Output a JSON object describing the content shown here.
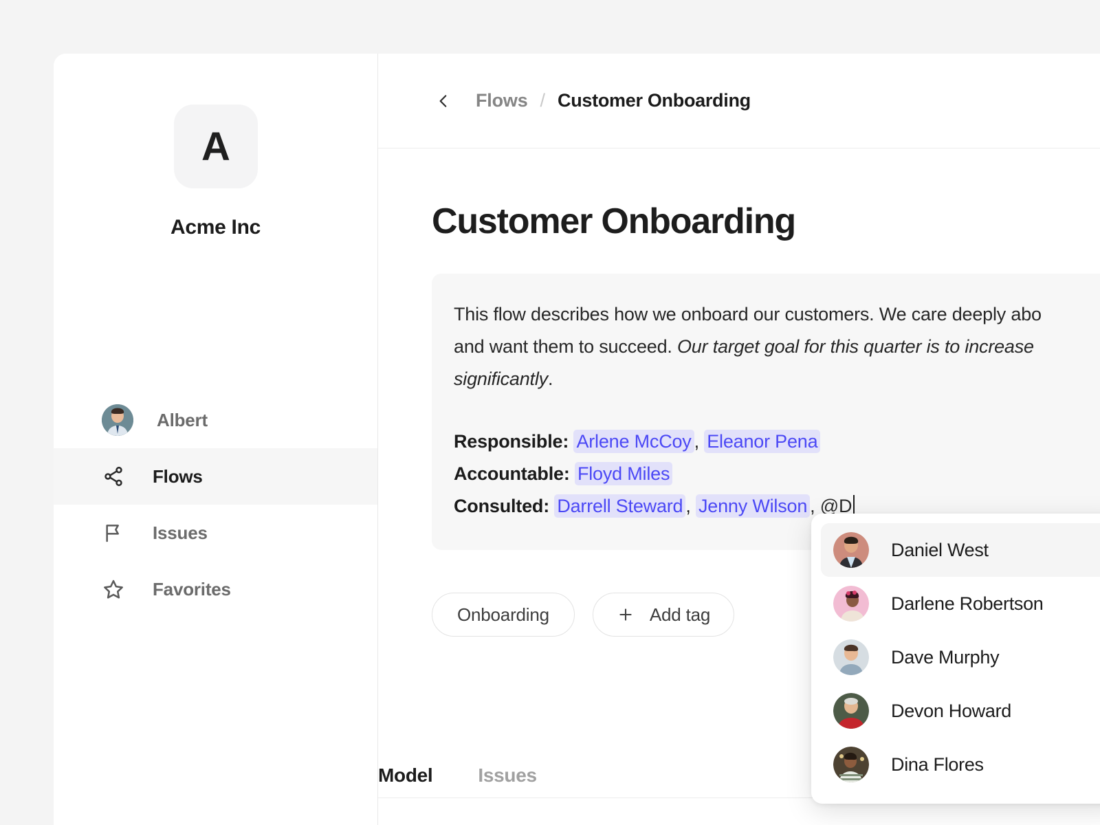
{
  "sidebar": {
    "org_initial": "A",
    "org_name": "Acme Inc",
    "user": {
      "name": "Albert",
      "avatar": "albert-avatar"
    },
    "items": [
      {
        "label": "Flows",
        "icon": "share-network-icon",
        "active": true
      },
      {
        "label": "Issues",
        "icon": "flag-icon",
        "active": false
      },
      {
        "label": "Favorites",
        "icon": "star-icon",
        "active": false
      }
    ]
  },
  "topbar": {
    "back_icon": "chevron-left-icon",
    "breadcrumb_parent": "Flows",
    "breadcrumb_separator": "/",
    "breadcrumb_current": "Customer Onboarding"
  },
  "page": {
    "title": "Customer Onboarding",
    "description": {
      "line1_plain": "This flow describes how we onboard our customers. We care deeply abo",
      "line2_plain": "and want them to succeed. ",
      "line2_italic": "Our target goal for this quarter is to increase",
      "line3_italic": "significantly",
      "line3_plain": "."
    },
    "raci": [
      {
        "label": "Responsible:",
        "mentions": [
          "Arlene McCoy",
          "Eleanor Pena"
        ],
        "separator": ", ",
        "trailing": ""
      },
      {
        "label": "Accountable:",
        "mentions": [
          "Floyd Miles"
        ],
        "separator": ", ",
        "trailing": ""
      },
      {
        "label": "Consulted:",
        "mentions": [
          "Darrell Steward",
          "Jenny Wilson"
        ],
        "separator": ", ",
        "trailing": ", @D"
      }
    ],
    "tags": {
      "existing": [
        "Onboarding"
      ],
      "add_label": "Add tag",
      "add_icon": "plus-icon"
    },
    "tabs": [
      {
        "label": "Model",
        "active": true
      },
      {
        "label": "Issues",
        "active": false
      }
    ]
  },
  "mention_dropdown": {
    "query": "@D",
    "items": [
      {
        "name": "Daniel West",
        "highlighted": true
      },
      {
        "name": "Darlene Robertson",
        "highlighted": false
      },
      {
        "name": "Dave Murphy",
        "highlighted": false
      },
      {
        "name": "Devon Howard",
        "highlighted": false
      },
      {
        "name": "Dina Flores",
        "highlighted": false
      }
    ]
  },
  "colors": {
    "mention_text": "#4b48f5",
    "mention_bg": "#e2e1fa",
    "panel_bg": "#f7f7f7",
    "active_nav_bg": "#f6f6f6",
    "page_bg": "#f4f4f4"
  }
}
